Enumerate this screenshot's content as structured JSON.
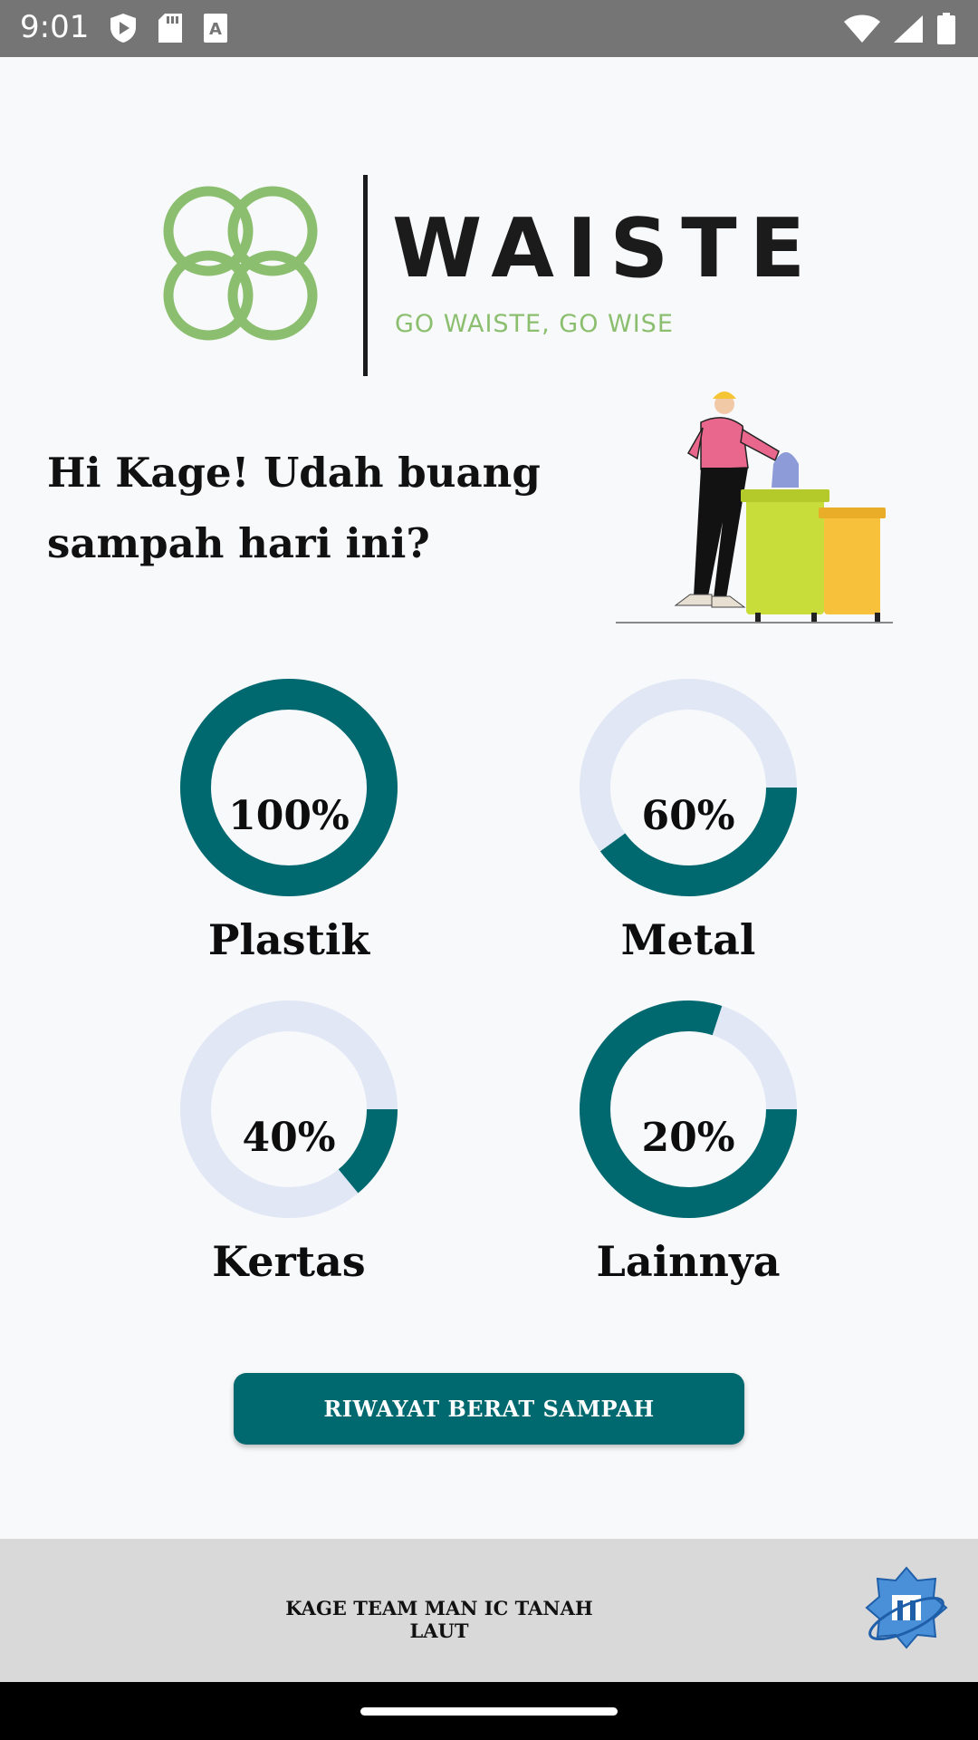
{
  "status_bar": {
    "time": "9:01",
    "icons_left": [
      "play-protect-icon",
      "sd-card-icon",
      "keyboard-a-icon"
    ],
    "icons_right": [
      "wifi-icon",
      "signal-icon",
      "battery-icon"
    ]
  },
  "logo": {
    "title": "WAISTE",
    "tagline": "GO WAISTE, GO WISE",
    "icon": "four-rings-logo-icon",
    "color": "#8bbf6f"
  },
  "greeting": "Hi Kage! Udah buang sampah hari ini?",
  "illustration": "person-throwing-trash-illustration",
  "categories": [
    {
      "name": "Plastik",
      "percent_label": "100%",
      "value": 1.0
    },
    {
      "name": "Metal",
      "percent_label": "60%",
      "value": 0.4
    },
    {
      "name": "Kertas",
      "percent_label": "40%",
      "value": 0.14
    },
    {
      "name": "Lainnya",
      "percent_label": "20%",
      "value": 0.8
    }
  ],
  "colors": {
    "ring_fill": "#00696f",
    "ring_track": "#e1e7f5",
    "button": "#00696f",
    "footer_bg": "#d9d9d9"
  },
  "button": {
    "label": "RIWAYAT BERAT SAMPAH"
  },
  "footer": {
    "text": "KAGE TEAM MAN IC TANAH LAUT",
    "emblem": "school-emblem-icon"
  }
}
